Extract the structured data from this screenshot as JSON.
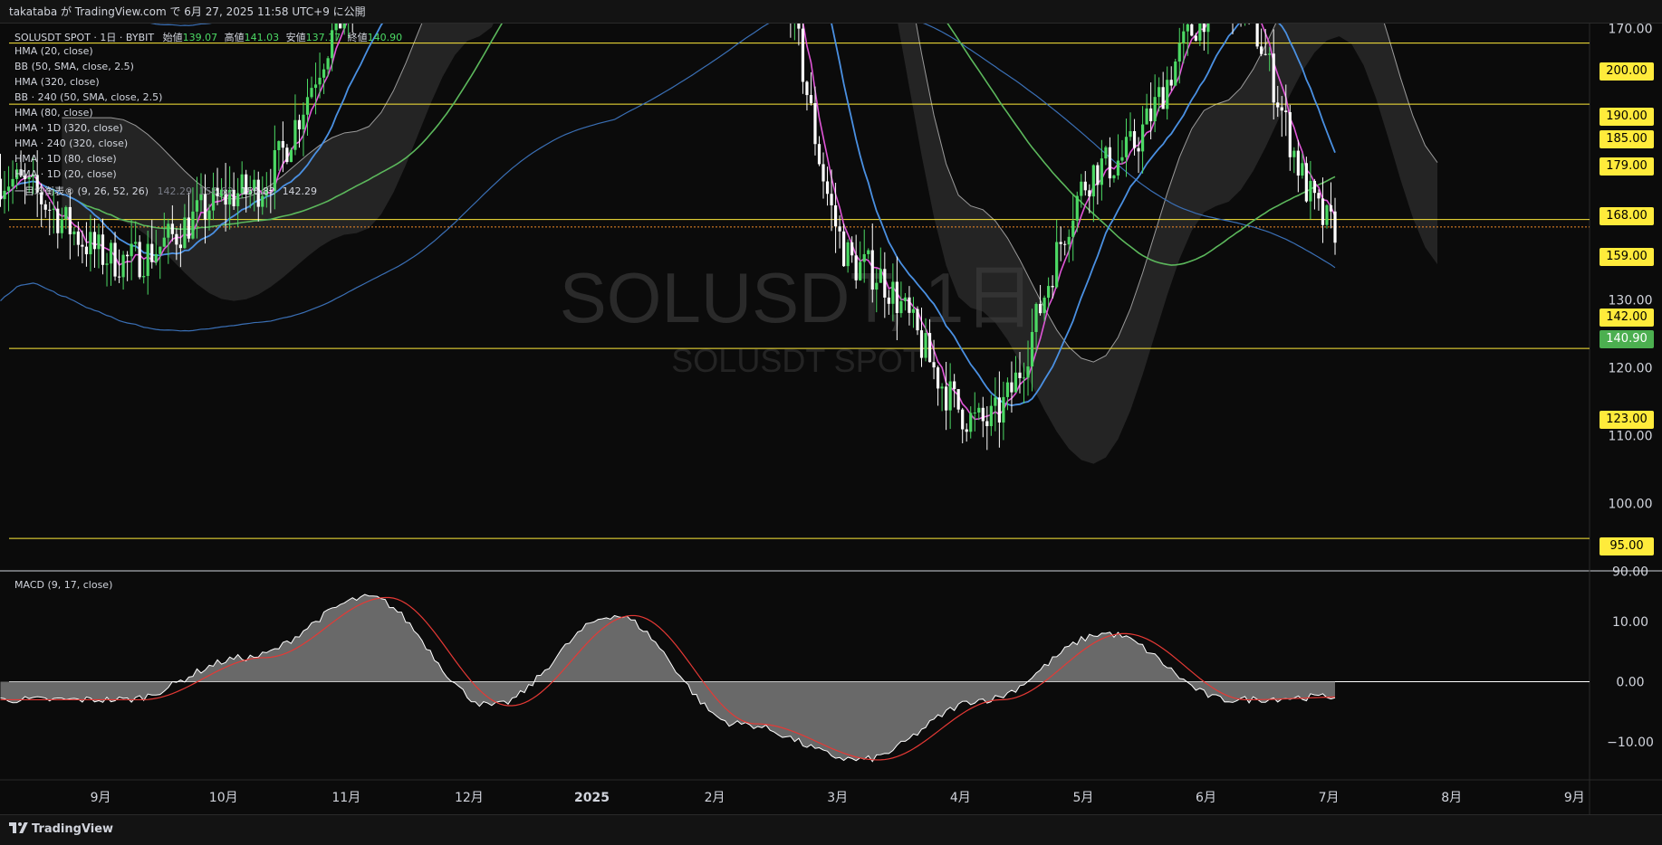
{
  "header": {
    "publish_text": "takataba が TradingView.com で 6月 27, 2025 11:58 UTC+9 に公開"
  },
  "legend": {
    "symbol_line": "SOLUSDT SPOT · 1日 · BYBIT",
    "open_label": "始値",
    "open": "139.07",
    "high_label": "高値",
    "high": "141.03",
    "low_label": "安値",
    "low": "137.17",
    "close_label": "終値",
    "close": "140.90",
    "indicators": [
      "HMA (20, close)",
      "BB (50, SMA, close, 2.5)",
      "HMA (320, close)",
      "BB · 240 (50, SMA, close, 2.5)",
      "HMA (80, close)",
      "HMA · 1D (320, close)",
      "HMA · 240 (320, close)",
      "HMA · 1D (80, close)",
      "HMA · 1D (20, close)"
    ],
    "ichimoku_label": "一目均衡表® (9, 26, 52, 26)",
    "ichimoku_values": [
      "142.29",
      "156.82",
      "156.82",
      "142.29"
    ],
    "macd_label": "MACD (9, 17, close)"
  },
  "watermark": {
    "symbol": "SOLUSDT, 1日",
    "sub": "SOLUSDT SPOT"
  },
  "footer": {
    "brand": "TradingView"
  },
  "colors": {
    "up": "#4cd964",
    "down": "#ffffff",
    "hma20": "#e056d8",
    "hma80": "#4a90e2",
    "hma320": "#5cb85c",
    "bb": "#3a6fb5",
    "level": "#ffeb3b",
    "macd": "#ffffff",
    "signal": "#e53935",
    "hist": "#7a7a7a",
    "cloud": "#555555"
  },
  "chart_data": {
    "type": "candlestick",
    "interval": "1日",
    "x_axis_labels": [
      "9月",
      "10月",
      "11月",
      "12月",
      "2025",
      "2月",
      "3月",
      "4月",
      "5月",
      "6月",
      "7月",
      "8月",
      "9月"
    ],
    "price_axis": {
      "ylim": [
        90,
        210
      ],
      "ticks": [
        90,
        100,
        110,
        120,
        130,
        150,
        170,
        210
      ]
    },
    "horizontal_levels": [
      200,
      190,
      185,
      179,
      168,
      159,
      142,
      123,
      95
    ],
    "current_price": 140.9,
    "monthly_anchors": [
      {
        "month": "2024-08",
        "price": 148
      },
      {
        "month": "2024-09",
        "price": 136
      },
      {
        "month": "2024-10",
        "price": 146
      },
      {
        "month": "2024-11",
        "price": 175
      },
      {
        "month": "2024-12",
        "price": 230
      },
      {
        "month": "2025-01",
        "price": 195
      },
      {
        "month": "2025-02",
        "price": 200
      },
      {
        "month": "2025-03",
        "price": 135
      },
      {
        "month": "2025-04",
        "price": 112
      },
      {
        "month": "2025-05",
        "price": 150
      },
      {
        "month": "2025-06",
        "price": 175
      },
      {
        "month": "2025-06-27",
        "price": 140.9
      }
    ],
    "macd": {
      "ylim": [
        -16,
        16
      ],
      "ticks": [
        10,
        0,
        -10
      ],
      "series": [
        {
          "month": "2024-09",
          "value": -3
        },
        {
          "month": "2024-10",
          "value": 4
        },
        {
          "month": "2024-11",
          "value": 14
        },
        {
          "month": "2024-12",
          "value": -4
        },
        {
          "month": "2025-01",
          "value": 11
        },
        {
          "month": "2025-02",
          "value": -7
        },
        {
          "month": "2025-03",
          "value": -13
        },
        {
          "month": "2025-04",
          "value": -3
        },
        {
          "month": "2025-05",
          "value": 8
        },
        {
          "month": "2025-06",
          "value": -3
        },
        {
          "month": "2025-06-27",
          "value": -2.5
        }
      ]
    }
  }
}
